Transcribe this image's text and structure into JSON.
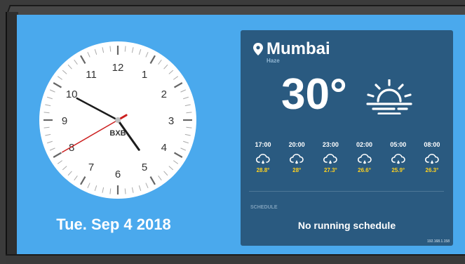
{
  "clock": {
    "numbers": [
      "12",
      "1",
      "2",
      "3",
      "4",
      "5",
      "6",
      "7",
      "8",
      "9",
      "10",
      "11"
    ],
    "brand": "BXB",
    "time": {
      "hour": 4,
      "minute": 49,
      "second": 40
    }
  },
  "date": "Tue. Sep 4 2018",
  "weather": {
    "city": "Mumbai",
    "condition": "Haze",
    "temperature": "30°",
    "icon": "sun-haze-icon",
    "forecast": [
      {
        "time": "17:00",
        "temp": "28.8°",
        "icon": "cloud-rain-icon"
      },
      {
        "time": "20:00",
        "temp": "28°",
        "icon": "cloud-rain-icon"
      },
      {
        "time": "23:00",
        "temp": "27.3°",
        "icon": "cloud-rain-icon"
      },
      {
        "time": "02:00",
        "temp": "26.6°",
        "icon": "cloud-rain-icon"
      },
      {
        "time": "05:00",
        "temp": "25.9°",
        "icon": "cloud-rain-icon"
      },
      {
        "time": "08:00",
        "temp": "26.3°",
        "icon": "cloud-rain-icon"
      }
    ]
  },
  "schedule": {
    "label": "SCHEDULE",
    "status": "No running schedule"
  },
  "ip": "192.168.1.158",
  "colors": {
    "background": "#4aa9ed",
    "card": "#2a5a80",
    "accent": "#ffd21f",
    "second_hand": "#cc1f1f"
  }
}
